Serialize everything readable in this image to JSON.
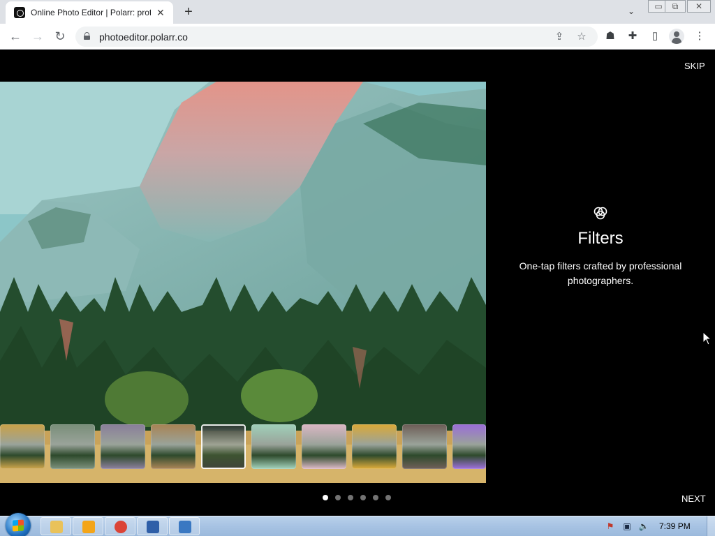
{
  "browser": {
    "tab": {
      "title": "Online Photo Editor | Polarr: prof",
      "close": "✕"
    },
    "new_tab": "+",
    "tab_search": "⌄",
    "window_controls": {
      "minimize": "▭",
      "restore": "⧉",
      "close": "✕"
    },
    "nav": {
      "back": "←",
      "forward": "→",
      "reload": "↻"
    },
    "address": {
      "url": "photoeditor.polarr.co"
    },
    "omnibox_icons": {
      "share": "⇪",
      "bookmark": "☆"
    },
    "toolbar_icons": {
      "extension_hat": "☗",
      "extensions": "✚",
      "side_panel": "▯",
      "menu": "⋮"
    }
  },
  "page": {
    "skip_label": "SKIP",
    "next_label": "NEXT",
    "feature": {
      "title": "Filters",
      "description": "One-tap filters crafted by professional photographers."
    },
    "pagination": {
      "total": 6,
      "active": 1
    },
    "filter_thumbnails": [
      {
        "tint": "#c9a24a",
        "active": false
      },
      {
        "tint": "#7a8f7a",
        "active": false
      },
      {
        "tint": "#8a7f9a",
        "active": false
      },
      {
        "tint": "#a88456",
        "active": false
      },
      {
        "tint": "#2f3a34",
        "active": true
      },
      {
        "tint": "#9fcfb8",
        "active": false
      },
      {
        "tint": "#d8b6c2",
        "active": false
      },
      {
        "tint": "#d9a93a",
        "active": false
      },
      {
        "tint": "#6e5f58",
        "active": false
      },
      {
        "tint": "#9a6fd6",
        "active": false
      }
    ]
  },
  "taskbar": {
    "apps": [
      {
        "name": "file-explorer",
        "color": "#e9c25a"
      },
      {
        "name": "media-player",
        "color": "#f3a51a"
      },
      {
        "name": "chrome",
        "color": "#db4437"
      },
      {
        "name": "document-app",
        "color": "#2f5fa8"
      },
      {
        "name": "window-app",
        "color": "#3a78c2"
      }
    ],
    "tray": {
      "flag": "⚑",
      "network": "▣",
      "volume": "🔈"
    },
    "clock": "7:39 PM"
  },
  "colors": {
    "page_bg": "#000000",
    "taskbar": "#a7c3e3",
    "chrome_tabstrip": "#dee1e6"
  }
}
